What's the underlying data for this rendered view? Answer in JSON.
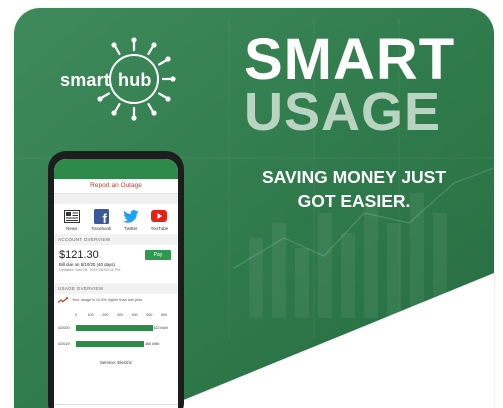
{
  "brand": {
    "logo_text_a": "smart",
    "logo_text_b": "hub"
  },
  "headline": {
    "line1": "SMART",
    "line2": "USAGE"
  },
  "tagline": {
    "line1": "SAVING MONEY JUST",
    "line2": "GOT EASIER."
  },
  "colors": {
    "green": "#2e8a4a",
    "light_green": "#b9d5c2",
    "red": "#c0392b"
  },
  "phone": {
    "outage_label": "Report an Outage",
    "social": [
      {
        "label": "News",
        "icon": "news-icon"
      },
      {
        "label": "Facebook",
        "icon": "facebook-icon"
      },
      {
        "label": "Twitter",
        "icon": "twitter-icon"
      },
      {
        "label": "YouTube",
        "icon": "youtube-icon"
      }
    ],
    "account": {
      "header": "ACCOUNT OVERVIEW",
      "amount": "$121.30",
      "due": "Bill due on 5/10/20 (40 days).",
      "updated": "Updated: Mar 28, 2020 08:00:04 PM",
      "pay_label": "Pay"
    },
    "usage": {
      "header": "USAGE OVERVIEW",
      "note": "Your usage is 10.8% higher than last year.",
      "axis": [
        "0",
        "100",
        "200",
        "300",
        "400",
        "500",
        "600"
      ],
      "rows": [
        {
          "label": "4/2020",
          "value": 522,
          "value_label": "522 kWh"
        },
        {
          "label": "4/2019",
          "value": 465,
          "value_label": "465 kWh"
        }
      ],
      "service": "Service: Electric"
    },
    "nav": [
      "⌂",
      "▭",
      "▤",
      "♙",
      "⋯"
    ]
  }
}
